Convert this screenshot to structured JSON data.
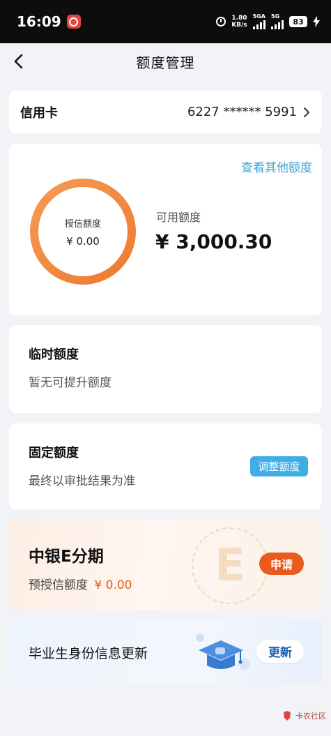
{
  "status_bar": {
    "time": "16:09",
    "net_speed_value": "1.80",
    "net_speed_unit": "KB/s",
    "sim1_label": "5GA",
    "sim2_label": "5G",
    "battery": "83"
  },
  "header": {
    "title": "额度管理"
  },
  "credit_card": {
    "label": "信用卡",
    "number": "6227 ****** 5991"
  },
  "limit": {
    "other_link": "查看其他额度",
    "granted_label": "授信额度",
    "granted_value": "¥ 0.00",
    "available_label": "可用额度",
    "available_value": "¥ 3,000.30",
    "ring_color": "#f0883f"
  },
  "temporary": {
    "title": "临时额度",
    "subtitle": "暂无可提升额度"
  },
  "fixed": {
    "title": "固定额度",
    "subtitle": "最终以审批结果为准",
    "button": "调整额度"
  },
  "installment": {
    "title": "中银E分期",
    "pre_label": "预授信额度",
    "pre_value": "¥ 0.00",
    "decor_letter": "E",
    "button": "申请"
  },
  "graduate": {
    "title": "毕业生身份信息更新",
    "button": "更新"
  },
  "watermark": {
    "text": "卡农社区"
  },
  "colors": {
    "accent_blue": "#3eaee6",
    "accent_orange": "#ea5a1e",
    "link_blue": "#3aa2d9"
  }
}
